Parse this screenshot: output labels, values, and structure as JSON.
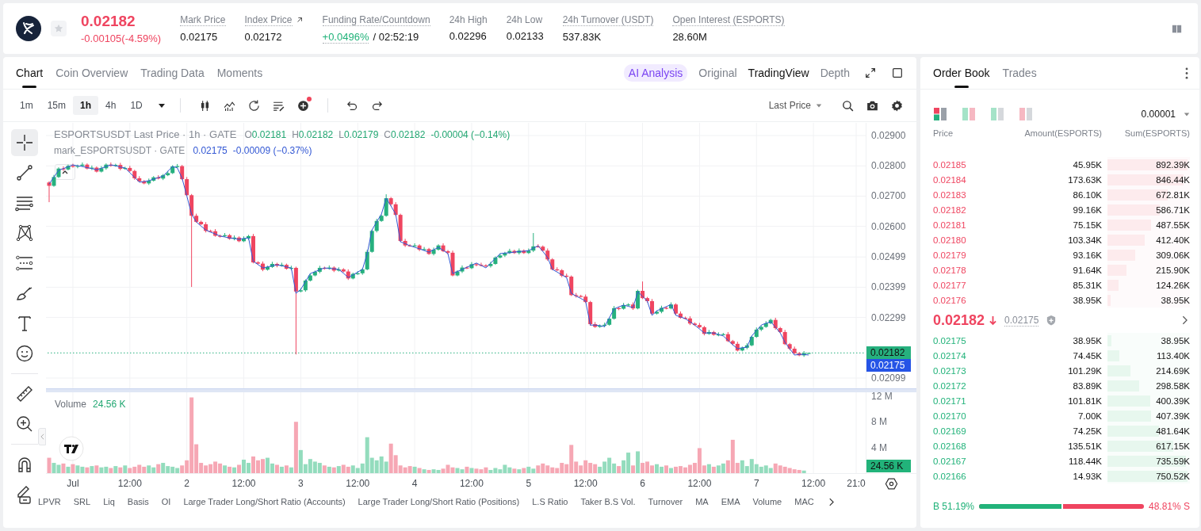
{
  "header": {
    "price": "0.02182",
    "falling": true,
    "change": "-0.00105(-4.59%)",
    "favorite": false,
    "stats": [
      {
        "kind": "plain",
        "label": "Mark Price",
        "value": "0.02175",
        "dotted": true
      },
      {
        "kind": "link",
        "label": "Index Price",
        "value": "0.02172",
        "dotted": true
      },
      {
        "kind": "funding",
        "label": "Funding Rate/Countdown",
        "value": "+0.0496%",
        "countdown": "/ 02:52:19",
        "dotted": true
      },
      {
        "kind": "plain",
        "label": "24h High",
        "value": "0.02296",
        "dotted": false
      },
      {
        "kind": "plain",
        "label": "24h Low",
        "value": "0.02133",
        "dotted": false
      },
      {
        "kind": "plain",
        "label": "24h Turnover (USDT)",
        "value": "537.83K",
        "dotted": true
      },
      {
        "kind": "plain",
        "label": "Open Interest (ESPORTS)",
        "value": "28.60M",
        "dotted": true
      }
    ]
  },
  "chart_panel": {
    "tabs": [
      {
        "label": "Chart",
        "selected": true
      },
      {
        "label": "Coin Overview",
        "selected": false
      },
      {
        "label": "Trading Data",
        "selected": false
      },
      {
        "label": "Moments",
        "selected": false
      }
    ],
    "ai_button": "AI Analysis",
    "views": [
      {
        "label": "Original",
        "selected": false
      },
      {
        "label": "TradingView",
        "selected": true
      },
      {
        "label": "Depth",
        "selected": false
      }
    ],
    "intervals": [
      {
        "label": "1m",
        "selected": false
      },
      {
        "label": "15m",
        "selected": false
      },
      {
        "label": "1h",
        "selected": true
      },
      {
        "label": "4h",
        "selected": false
      },
      {
        "label": "1D",
        "selected": false
      }
    ],
    "indicator_badge": true,
    "price_source": "Last Price",
    "drawing_tools": [
      {
        "kind": "crosshair",
        "selected": true
      },
      {
        "kind": "trend-line",
        "selected": false
      },
      {
        "kind": "fib",
        "selected": false
      },
      {
        "kind": "pattern",
        "selected": false
      },
      {
        "kind": "projection",
        "selected": false
      },
      {
        "kind": "brush",
        "selected": false
      },
      {
        "kind": "text",
        "selected": false
      },
      {
        "kind": "emoji",
        "selected": false
      },
      {
        "kind": "ruler",
        "selected": false
      },
      {
        "kind": "zoom",
        "selected": false
      },
      {
        "kind": "magnet",
        "selected": false
      },
      {
        "kind": "pencil",
        "selected": false
      }
    ],
    "price_chart": {
      "legend": {
        "ohlc": [
          {
            "key": "O",
            "value": "0.02181"
          },
          {
            "key": "H",
            "value": "0.02182"
          },
          {
            "key": "L",
            "value": "0.02179"
          },
          {
            "key": "C",
            "value": "0.02182"
          }
        ],
        "change": "-0.00004 (−0.14%)",
        "mark_value": "0.02175",
        "mark_change": "-0.00009 (−0.37%)"
      },
      "price_tags": [
        {
          "kind": "mark",
          "value": "0.02175"
        }
      ],
      "chart_data": {
        "type": "candlestick",
        "title": "ESPORTSUSDT Last Price · 1h · GATE",
        "grid": true,
        "categories": [
          null,
          null,
          null,
          null,
          null,
          null,
          null,
          null,
          null,
          null,
          null,
          null,
          null,
          null,
          null,
          null,
          null,
          null,
          null,
          null,
          null,
          null,
          null,
          null,
          null,
          null,
          null,
          null,
          null,
          null,
          null,
          null,
          null,
          null,
          null,
          null,
          null,
          null,
          null,
          null,
          null,
          null,
          null,
          null,
          null,
          null,
          null,
          null,
          null,
          null,
          null,
          null,
          null,
          null,
          null,
          null,
          null,
          null,
          null,
          null,
          null,
          null,
          null,
          null,
          null,
          null,
          null,
          null,
          null,
          null,
          null,
          null,
          null,
          null,
          null,
          null,
          null,
          null,
          null,
          null,
          null,
          null,
          null,
          null,
          null,
          null,
          null,
          null,
          null,
          null,
          null,
          null,
          null,
          null,
          null,
          null,
          null,
          null,
          null,
          null,
          null,
          null,
          null,
          null,
          null,
          null,
          null,
          null,
          null,
          null,
          null,
          null,
          null,
          null,
          null,
          null,
          null,
          null,
          null,
          null,
          null,
          null,
          null,
          null,
          null,
          null,
          null,
          null,
          null,
          null,
          null,
          null,
          null,
          null,
          null,
          null,
          null,
          null,
          null,
          null,
          null,
          null,
          null,
          null,
          null,
          null,
          null,
          null,
          null,
          null,
          null,
          null,
          null,
          null,
          null,
          null,
          null,
          null,
          null,
          null,
          null,
          null,
          null,
          null,
          null,
          null,
          null,
          null,
          null,
          null,
          null,
          null
        ],
        "ohlc": [
          [
            0.02745,
            0.02749,
            0.0268,
            0.02734
          ],
          [
            0.02734,
            0.0277,
            0.02731,
            0.02763
          ],
          [
            0.02763,
            0.02795,
            0.0276,
            0.02791
          ],
          [
            0.02791,
            0.02798,
            0.02783,
            0.02788
          ],
          [
            0.02788,
            0.02804,
            0.02785,
            0.028
          ],
          [
            0.028,
            0.02807,
            0.02794,
            0.02797
          ],
          [
            0.02797,
            0.02804,
            0.02792,
            0.028
          ],
          [
            0.028,
            0.02811,
            0.02797,
            0.02804
          ],
          [
            0.02804,
            0.02808,
            0.02788,
            0.02791
          ],
          [
            0.02791,
            0.02801,
            0.02786,
            0.02794
          ],
          [
            0.02794,
            0.02798,
            0.02778,
            0.02781
          ],
          [
            0.02781,
            0.02799,
            0.02778,
            0.02792
          ],
          [
            0.02792,
            0.02808,
            0.02787,
            0.02804
          ],
          [
            0.02804,
            0.02811,
            0.02797,
            0.028
          ],
          [
            0.028,
            0.02807,
            0.02797,
            0.02803
          ],
          [
            0.02803,
            0.0281,
            0.02785,
            0.0279
          ],
          [
            0.0279,
            0.02797,
            0.02787,
            0.02793
          ],
          [
            0.02793,
            0.028,
            0.0278,
            0.02783
          ],
          [
            0.02783,
            0.02787,
            0.02754,
            0.02759
          ],
          [
            0.02759,
            0.02766,
            0.02746,
            0.02749
          ],
          [
            0.02749,
            0.02753,
            0.02739,
            0.02742
          ],
          [
            0.02742,
            0.02758,
            0.02737,
            0.02751
          ],
          [
            0.02751,
            0.02766,
            0.02748,
            0.02762
          ],
          [
            0.02762,
            0.02769,
            0.02755,
            0.02758
          ],
          [
            0.02758,
            0.02773,
            0.02753,
            0.02769
          ],
          [
            0.02769,
            0.02783,
            0.02766,
            0.02776
          ],
          [
            0.02776,
            0.02802,
            0.02773,
            0.02798
          ],
          [
            0.02798,
            0.02806,
            0.02793,
            0.02799
          ],
          [
            0.02799,
            0.02803,
            0.02753,
            0.02756
          ],
          [
            0.02756,
            0.02763,
            0.027,
            0.02703
          ],
          [
            0.02703,
            0.02707,
            0.024,
            0.02635
          ],
          [
            0.02635,
            0.02642,
            0.02612,
            0.02615
          ],
          [
            0.02615,
            0.02619,
            0.02604,
            0.02607
          ],
          [
            0.02607,
            0.02614,
            0.0258,
            0.02585
          ],
          [
            0.02585,
            0.02589,
            0.02581,
            0.02584
          ],
          [
            0.02584,
            0.02591,
            0.02566,
            0.02569
          ],
          [
            0.02569,
            0.02573,
            0.02563,
            0.02568
          ],
          [
            0.02568,
            0.02578,
            0.02565,
            0.02571
          ],
          [
            0.02571,
            0.02575,
            0.02556,
            0.02559
          ],
          [
            0.02559,
            0.0257,
            0.02554,
            0.02563
          ],
          [
            0.02563,
            0.02567,
            0.02548,
            0.02551
          ],
          [
            0.02551,
            0.02567,
            0.02548,
            0.0256
          ],
          [
            0.0256,
            0.02572,
            0.02555,
            0.02568
          ],
          [
            0.02568,
            0.02575,
            0.02478,
            0.02481
          ],
          [
            0.02481,
            0.02485,
            0.02474,
            0.02477
          ],
          [
            0.02477,
            0.02484,
            0.02452,
            0.02457
          ],
          [
            0.02457,
            0.0247,
            0.02454,
            0.02466
          ],
          [
            0.02466,
            0.02483,
            0.02463,
            0.02476
          ],
          [
            0.02476,
            0.0248,
            0.02465,
            0.0247
          ],
          [
            0.0247,
            0.0248,
            0.02467,
            0.02473
          ],
          [
            0.02473,
            0.02477,
            0.02457,
            0.0246
          ],
          [
            0.0246,
            0.0247,
            0.02455,
            0.02463
          ],
          [
            0.02463,
            0.02467,
            0.02177,
            0.02385
          ],
          [
            0.02385,
            0.02396,
            0.02382,
            0.02389
          ],
          [
            0.02389,
            0.02425,
            0.02384,
            0.02421
          ],
          [
            0.02421,
            0.02445,
            0.02418,
            0.02438
          ],
          [
            0.02438,
            0.02454,
            0.02435,
            0.0245
          ],
          [
            0.0245,
            0.0247,
            0.02445,
            0.02463
          ],
          [
            0.02463,
            0.02467,
            0.02457,
            0.0246
          ],
          [
            0.0246,
            0.02471,
            0.02457,
            0.02464
          ],
          [
            0.02464,
            0.02468,
            0.02449,
            0.02454
          ],
          [
            0.02454,
            0.02465,
            0.02451,
            0.02458
          ],
          [
            0.02458,
            0.02462,
            0.02448,
            0.02451
          ],
          [
            0.02451,
            0.02458,
            0.02423,
            0.02428
          ],
          [
            0.02428,
            0.02447,
            0.02425,
            0.02443
          ],
          [
            0.02443,
            0.02452,
            0.0244,
            0.02445
          ],
          [
            0.02445,
            0.02462,
            0.0244,
            0.02458
          ],
          [
            0.02458,
            0.02523,
            0.02455,
            0.02516
          ],
          [
            0.02516,
            0.02589,
            0.02513,
            0.02585
          ],
          [
            0.02585,
            0.02625,
            0.0258,
            0.02618
          ],
          [
            0.02618,
            0.02639,
            0.02615,
            0.02635
          ],
          [
            0.02635,
            0.02706,
            0.02632,
            0.02693
          ],
          [
            0.02693,
            0.02697,
            0.02668,
            0.02673
          ],
          [
            0.02673,
            0.0268,
            0.02635,
            0.02638
          ],
          [
            0.02638,
            0.02642,
            0.02549,
            0.02552
          ],
          [
            0.02552,
            0.02559,
            0.02532,
            0.02537
          ],
          [
            0.02537,
            0.02541,
            0.02533,
            0.02536
          ],
          [
            0.02536,
            0.02544,
            0.02533,
            0.02537
          ],
          [
            0.02537,
            0.02541,
            0.02518,
            0.02523
          ],
          [
            0.02523,
            0.02532,
            0.0252,
            0.02525
          ],
          [
            0.02525,
            0.02529,
            0.02506,
            0.02509
          ],
          [
            0.02509,
            0.0253,
            0.02504,
            0.02523
          ],
          [
            0.02523,
            0.02541,
            0.0252,
            0.02537
          ],
          [
            0.02537,
            0.02544,
            0.02515,
            0.02518
          ],
          [
            0.02518,
            0.02522,
            0.02508,
            0.02513
          ],
          [
            0.02513,
            0.0252,
            0.02435,
            0.02438
          ],
          [
            0.02438,
            0.02455,
            0.02435,
            0.02451
          ],
          [
            0.02451,
            0.02471,
            0.02446,
            0.02464
          ],
          [
            0.02464,
            0.02468,
            0.02459,
            0.02462
          ],
          [
            0.02462,
            0.02482,
            0.02459,
            0.02475
          ],
          [
            0.02475,
            0.02479,
            0.02468,
            0.02473
          ],
          [
            0.02473,
            0.0248,
            0.02468,
            0.02471
          ],
          [
            0.02471,
            0.02475,
            0.02466,
            0.02469
          ],
          [
            0.02469,
            0.02483,
            0.02464,
            0.02476
          ],
          [
            0.02476,
            0.02501,
            0.02473,
            0.02497
          ],
          [
            0.02497,
            0.02511,
            0.02494,
            0.02504
          ],
          [
            0.02504,
            0.02516,
            0.02499,
            0.02512
          ],
          [
            0.02512,
            0.02526,
            0.02509,
            0.02519
          ],
          [
            0.02519,
            0.02523,
            0.02509,
            0.02512
          ],
          [
            0.02512,
            0.02527,
            0.02507,
            0.0252
          ],
          [
            0.0252,
            0.02524,
            0.02509,
            0.02512
          ],
          [
            0.02512,
            0.02527,
            0.02509,
            0.0252
          ],
          [
            0.0252,
            0.02578,
            0.02515,
            0.02534
          ],
          [
            0.02534,
            0.02541,
            0.0253,
            0.02533
          ],
          [
            0.02533,
            0.02537,
            0.02517,
            0.0252
          ],
          [
            0.0252,
            0.02527,
            0.02486,
            0.02491
          ],
          [
            0.02491,
            0.02495,
            0.02455,
            0.02458
          ],
          [
            0.02458,
            0.02465,
            0.02452,
            0.02455
          ],
          [
            0.02455,
            0.02459,
            0.02432,
            0.02437
          ],
          [
            0.02437,
            0.02444,
            0.02431,
            0.02434
          ],
          [
            0.02434,
            0.02438,
            0.0237,
            0.02373
          ],
          [
            0.02373,
            0.0238,
            0.02365,
            0.0237
          ],
          [
            0.0237,
            0.02374,
            0.02365,
            0.02368
          ],
          [
            0.02368,
            0.02375,
            0.02347,
            0.0235
          ],
          [
            0.0235,
            0.02354,
            0.02272,
            0.02277
          ],
          [
            0.02277,
            0.02284,
            0.02265,
            0.02268
          ],
          [
            0.02268,
            0.02276,
            0.02265,
            0.02272
          ],
          [
            0.02272,
            0.02282,
            0.02267,
            0.02275
          ],
          [
            0.02275,
            0.02299,
            0.02272,
            0.02295
          ],
          [
            0.02295,
            0.02337,
            0.02292,
            0.0233
          ],
          [
            0.0233,
            0.02334,
            0.02323,
            0.02328
          ],
          [
            0.02328,
            0.02347,
            0.02325,
            0.0234
          ],
          [
            0.0234,
            0.02346,
            0.02337,
            0.02342
          ],
          [
            0.02342,
            0.02349,
            0.02324,
            0.02329
          ],
          [
            0.02329,
            0.02391,
            0.02326,
            0.02387
          ],
          [
            0.02387,
            0.02418,
            0.0236,
            0.02363
          ],
          [
            0.02363,
            0.02367,
            0.02348,
            0.02353
          ],
          [
            0.02353,
            0.0236,
            0.02309,
            0.02312
          ],
          [
            0.02312,
            0.02322,
            0.02309,
            0.02318
          ],
          [
            0.02318,
            0.02338,
            0.02313,
            0.02331
          ],
          [
            0.02331,
            0.02335,
            0.02326,
            0.02329
          ],
          [
            0.02329,
            0.02349,
            0.02326,
            0.02342
          ],
          [
            0.02342,
            0.02346,
            0.02307,
            0.02312
          ],
          [
            0.02312,
            0.02319,
            0.02295,
            0.02298
          ],
          [
            0.02298,
            0.02302,
            0.02293,
            0.02296
          ],
          [
            0.02296,
            0.02303,
            0.02274,
            0.02279
          ],
          [
            0.02279,
            0.02283,
            0.02271,
            0.02274
          ],
          [
            0.02274,
            0.02281,
            0.02264,
            0.02267
          ],
          [
            0.02267,
            0.02271,
            0.0224,
            0.02245
          ],
          [
            0.02245,
            0.02258,
            0.02242,
            0.02251
          ],
          [
            0.02251,
            0.02255,
            0.02239,
            0.02242
          ],
          [
            0.02242,
            0.0225,
            0.02237,
            0.02243
          ],
          [
            0.02243,
            0.02248,
            0.0224,
            0.02244
          ],
          [
            0.02244,
            0.02251,
            0.02218,
            0.02221
          ],
          [
            0.02221,
            0.02225,
            0.02207,
            0.02212
          ],
          [
            0.02212,
            0.02219,
            0.02187,
            0.0219
          ],
          [
            0.0219,
            0.02203,
            0.02187,
            0.02199
          ],
          [
            0.02199,
            0.02214,
            0.02194,
            0.02207
          ],
          [
            0.02207,
            0.02239,
            0.02204,
            0.02235
          ],
          [
            0.02235,
            0.02266,
            0.02232,
            0.02259
          ],
          [
            0.02259,
            0.02272,
            0.02254,
            0.02268
          ],
          [
            0.02268,
            0.02287,
            0.02265,
            0.0228
          ],
          [
            0.0228,
            0.02295,
            0.02277,
            0.02291
          ],
          [
            0.02291,
            0.02298,
            0.02259,
            0.02264
          ],
          [
            0.02264,
            0.02268,
            0.02248,
            0.02251
          ],
          [
            0.02251,
            0.02258,
            0.02208,
            0.02211
          ],
          [
            0.02211,
            0.02215,
            0.02191,
            0.02196
          ],
          [
            0.02196,
            0.02203,
            0.02178,
            0.02181
          ],
          [
            0.02181,
            0.02185,
            0.02171,
            0.02174
          ],
          [
            0.02174,
            0.02188,
            0.02169,
            0.02181
          ],
          [
            0.02181,
            0.02182,
            0.02179,
            0.02182
          ],
          null,
          null,
          null,
          null,
          null,
          null,
          null,
          null,
          null,
          null,
          null
        ],
        "series": [
          {
            "name": "mark_ESPORTSUSDT · GATE",
            "type": "line",
            "color": "#3358d4",
            "values": [
              0.0274,
              0.02763,
              0.02785,
              0.02791,
              0.02797,
              0.02803,
              0.028,
              0.02798,
              0.02794,
              0.02791,
              0.02787,
              0.02792,
              0.02798,
              0.02803,
              0.028,
              0.02796,
              0.02793,
              0.02777,
              0.02762,
              0.02746,
              0.02748,
              0.02751,
              0.02756,
              0.02761,
              0.02766,
              0.02782,
              0.02798,
              0.02793,
              0.02759,
              0.027,
              0.02641,
              0.02615,
              0.02601,
              0.02588,
              0.02581,
              0.02575,
              0.02568,
              0.02565,
              0.02562,
              0.0256,
              0.02557,
              0.0256,
              0.02562,
              0.02484,
              0.02474,
              0.02463,
              0.02466,
              0.0247,
              0.02473,
              0.0247,
              0.02466,
              0.02463,
              0.02379,
              0.02392,
              0.02418,
              0.02444,
              0.0245,
              0.02457,
              0.02463,
              0.02461,
              0.0246,
              0.02458,
              0.02445,
              0.02431,
              0.0244,
              0.02449,
              0.02458,
              0.0251,
              0.02588,
              0.02615,
              0.02641,
              0.02693,
              0.02667,
              0.02641,
              0.02549,
              0.02543,
              0.02536,
              0.02531,
              0.02526,
              0.0252,
              0.02515,
              0.02523,
              0.02531,
              0.02521,
              0.0251,
              0.02444,
              0.02451,
              0.02458,
              0.02465,
              0.02472,
              0.02479,
              0.02471,
              0.02463,
              0.02479,
              0.02494,
              0.0251,
              0.02512,
              0.02513,
              0.02515,
              0.02517,
              0.02518,
              0.0252,
              0.02528,
              0.02536,
              0.02517,
              0.02497,
              0.02458,
              0.02449,
              0.0244,
              0.02431,
              0.02379,
              0.0237,
              0.02362,
              0.02353,
              0.02274,
              0.02274,
              0.02272,
              0.02269,
              0.02298,
              0.02327,
              0.02334,
              0.0234,
              0.02336,
              0.02332,
              0.02384,
              0.02369,
              0.02353,
              0.02306,
              0.02321,
              0.02328,
              0.02335,
              0.02342,
              0.02306,
              0.02301,
              0.02295,
              0.02285,
              0.02274,
              0.02261,
              0.02248,
              0.02248,
              0.02248,
              0.02243,
              0.02238,
              0.02224,
              0.02209,
              0.02196,
              0.02199,
              0.02201,
              0.02238,
              0.02256,
              0.02274,
              0.0228,
              0.02285,
              0.02267,
              0.02248,
              0.02217,
              0.02196,
              0.02175,
              0.02177,
              0.02177,
              0.02175,
              null,
              null,
              null,
              null,
              null,
              null,
              null,
              null,
              null,
              null,
              null
            ]
          }
        ],
        "ref_lines": [
          {
            "axis": "y",
            "value": 0.02182,
            "label": "0.02182",
            "color": "#26b07e"
          }
        ],
        "ylim": [
          0.02065,
          0.02942
        ],
        "yticks": [
          {
            "value": 0.029,
            "label": "0.02900"
          },
          {
            "value": 0.028,
            "label": "0.02800"
          },
          {
            "value": 0.027,
            "label": "0.02700"
          },
          {
            "value": 0.026,
            "label": "0.02600"
          },
          {
            "value": 0.02499,
            "label": "0.02499"
          },
          {
            "value": 0.02399,
            "label": "0.02399"
          },
          {
            "value": 0.02299,
            "label": "0.02299"
          },
          {
            "value": 0.02099,
            "label": "0.02099"
          }
        ]
      }
    },
    "volume_chart": {
      "value": "24.56 K",
      "tag": "24.56 K",
      "chart_data": {
        "type": "bar",
        "grid": true,
        "categories": [
          null,
          null,
          null,
          null,
          null,
          "Jul",
          null,
          null,
          null,
          null,
          null,
          null,
          null,
          null,
          null,
          null,
          null,
          "12:00",
          null,
          null,
          null,
          null,
          null,
          null,
          null,
          null,
          null,
          null,
          null,
          "2",
          null,
          null,
          null,
          null,
          null,
          null,
          null,
          null,
          null,
          null,
          null,
          "12:00",
          null,
          null,
          null,
          null,
          null,
          null,
          null,
          null,
          null,
          null,
          null,
          "3",
          null,
          null,
          null,
          null,
          null,
          null,
          null,
          null,
          null,
          null,
          null,
          "12:00",
          null,
          null,
          null,
          null,
          null,
          null,
          null,
          null,
          null,
          null,
          null,
          "4",
          null,
          null,
          null,
          null,
          null,
          null,
          null,
          null,
          null,
          null,
          null,
          "12:00",
          null,
          null,
          null,
          null,
          null,
          null,
          null,
          null,
          null,
          null,
          null,
          "5",
          null,
          null,
          null,
          null,
          null,
          null,
          null,
          null,
          null,
          null,
          null,
          "12:00",
          null,
          null,
          null,
          null,
          null,
          null,
          null,
          null,
          null,
          null,
          null,
          "6",
          null,
          null,
          null,
          null,
          null,
          null,
          null,
          null,
          null,
          null,
          null,
          "12:00",
          null,
          null,
          null,
          null,
          null,
          null,
          null,
          null,
          null,
          null,
          null,
          "7",
          null,
          null,
          null,
          null,
          null,
          null,
          null,
          null,
          null,
          null,
          null,
          "12:00",
          null,
          null,
          null,
          null,
          null,
          null,
          null,
          null,
          "21:0",
          null
        ],
        "series": [
          {
            "name": "Volume",
            "values": [
              2.4,
              1.6,
              1.3,
              1.5,
              1.0,
              1.4,
              1.2,
              1.0,
              0.9,
              1.1,
              1.2,
              0.9,
              1.0,
              0.8,
              1.1,
              0.9,
              1.2,
              0.8,
              1.0,
              1.3,
              1.0,
              1.2,
              0.9,
              1.4,
              1.6,
              1.1,
              1.0,
              0.8,
              1.2,
              2.0,
              11.8,
              4.5,
              1.6,
              1.2,
              1.4,
              1.8,
              1.5,
              1.2,
              1.0,
              0.9,
              1.3,
              2.1,
              1.6,
              2.6,
              2.0,
              2.2,
              2.4,
              1.5,
              1.3,
              1.0,
              1.2,
              0.9,
              8.0,
              3.6,
              1.4,
              2.2,
              1.8,
              1.6,
              1.2,
              1.0,
              0.9,
              1.1,
              1.3,
              1.0,
              1.2,
              0.8,
              1.5,
              5.6,
              2.4,
              2.0,
              2.6,
              1.8,
              4.6,
              2.8,
              1.2,
              0.9,
              1.1,
              1.0,
              0.8,
              0.6,
              0.5,
              0.6,
              0.5,
              0.7,
              1.3,
              0.9,
              0.8,
              0.6,
              1.0,
              0.8,
              0.7,
              0.6,
              0.9,
              0.5,
              0.8,
              0.6,
              1.3,
              0.9,
              0.7,
              0.6,
              0.8,
              1.0,
              0.7,
              1.2,
              1.5,
              1.2,
              0.9,
              0.8,
              1.6,
              1.4,
              4.4,
              1.8,
              1.2,
              2.0,
              1.6,
              1.4,
              1.0,
              1.8,
              2.4,
              1.5,
              1.1,
              2.0,
              3.2,
              1.2,
              3.4,
              1.6,
              1.8,
              1.2,
              1.4,
              1.0,
              1.2,
              0.8,
              1.0,
              1.1,
              0.9,
              1.3,
              1.6,
              3.9,
              1.2,
              1.4,
              1.0,
              1.2,
              1.5,
              2.0,
              5.2,
              1.6,
              2.0,
              1.1,
              2.2,
              1.4,
              1.0,
              1.2,
              0.8,
              1.5,
              1.2,
              1.0,
              0.8,
              0.6,
              0.5,
              0.4,
              null,
              null,
              null,
              null,
              null,
              null,
              null,
              null,
              null,
              null,
              null,
              null
            ]
          }
        ],
        "ylim": [
          0,
          12.6
        ],
        "yticks": [
          {
            "value": 12,
            "label": "12 M"
          },
          {
            "value": 8,
            "label": "8 M"
          },
          {
            "value": 4,
            "label": "4 M"
          }
        ]
      }
    },
    "indicators": [
      "LPVR",
      "SRL",
      "Liq",
      "Basis",
      "OI",
      "Large Trader Long/Short Ratio (Accounts)",
      "Large Trader Long/Short Ratio (Positions)",
      "L.S Ratio",
      "Taker B.S Vol.",
      "Turnover",
      "MA",
      "EMA",
      "Volume",
      "MAC"
    ]
  },
  "order_book": {
    "tabs": [
      {
        "label": "Order Book",
        "selected": true
      },
      {
        "label": "Trades",
        "selected": false
      }
    ],
    "precision": "0.00001",
    "columns": [
      "Price",
      "Amount(ESPORTS)",
      "Sum(ESPORTS)"
    ],
    "asks": [
      {
        "price": "0.02185",
        "amount": "45.95K",
        "sum": "892.39K",
        "level": 1.0
      },
      {
        "price": "0.02184",
        "amount": "173.63K",
        "sum": "846.44K",
        "level": 0.949
      },
      {
        "price": "0.02183",
        "amount": "86.10K",
        "sum": "672.81K",
        "level": 0.754
      },
      {
        "price": "0.02182",
        "amount": "99.16K",
        "sum": "586.71K",
        "level": 0.657
      },
      {
        "price": "0.02181",
        "amount": "75.15K",
        "sum": "487.55K",
        "level": 0.546
      },
      {
        "price": "0.02180",
        "amount": "103.34K",
        "sum": "412.40K",
        "level": 0.462
      },
      {
        "price": "0.02179",
        "amount": "93.16K",
        "sum": "309.06K",
        "level": 0.346
      },
      {
        "price": "0.02178",
        "amount": "91.64K",
        "sum": "215.90K",
        "level": 0.242
      },
      {
        "price": "0.02177",
        "amount": "85.31K",
        "sum": "124.26K",
        "level": 0.139
      },
      {
        "price": "0.02176",
        "amount": "38.95K",
        "sum": "38.95K",
        "level": 0.044
      }
    ],
    "last": {
      "price": "0.02182",
      "falling": true,
      "mark": "0.02175"
    },
    "bids": [
      {
        "price": "0.02175",
        "amount": "38.95K",
        "sum": "38.95K",
        "level": 0.052
      },
      {
        "price": "0.02174",
        "amount": "74.45K",
        "sum": "113.40K",
        "level": 0.151
      },
      {
        "price": "0.02173",
        "amount": "101.29K",
        "sum": "214.69K",
        "level": 0.286
      },
      {
        "price": "0.02172",
        "amount": "83.89K",
        "sum": "298.58K",
        "level": 0.398
      },
      {
        "price": "0.02171",
        "amount": "101.81K",
        "sum": "400.39K",
        "level": 0.533
      },
      {
        "price": "0.02170",
        "amount": "7.00K",
        "sum": "407.39K",
        "level": 0.543
      },
      {
        "price": "0.02169",
        "amount": "74.25K",
        "sum": "481.64K",
        "level": 0.642
      },
      {
        "price": "0.02168",
        "amount": "135.51K",
        "sum": "617.15K",
        "level": 0.822
      },
      {
        "price": "0.02167",
        "amount": "118.44K",
        "sum": "735.59K",
        "level": 0.98
      },
      {
        "price": "0.02166",
        "amount": "14.93K",
        "sum": "750.52K",
        "level": 1.0
      }
    ],
    "ratio": {
      "buy": "B 51.19%",
      "sell": "48.81% S",
      "level": 0.5119
    }
  }
}
